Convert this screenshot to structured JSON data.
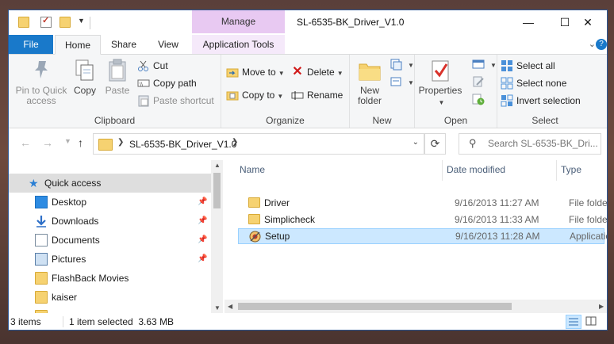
{
  "window": {
    "title": "SL-6535-BK_Driver_V1.0",
    "contextual_tab_group": "Manage",
    "min_glyph": "—",
    "max_glyph": "☐",
    "close_glyph": "✕"
  },
  "ribbon_tabs": {
    "file": "File",
    "home": "Home",
    "share": "Share",
    "view": "View",
    "application_tools": "Application Tools"
  },
  "clipboard": {
    "pin": "Pin to Quick access",
    "copy": "Copy",
    "paste": "Paste",
    "cut": "Cut",
    "copy_path": "Copy path",
    "paste_shortcut": "Paste shortcut",
    "label": "Clipboard"
  },
  "organize": {
    "move_to": "Move to",
    "copy_to": "Copy to",
    "delete": "Delete",
    "rename": "Rename",
    "label": "Organize"
  },
  "new_group": {
    "new_folder": "New folder",
    "label": "New"
  },
  "open_group": {
    "properties": "Properties",
    "label": "Open"
  },
  "select_group": {
    "select_all": "Select all",
    "select_none": "Select none",
    "invert_selection": "Invert selection",
    "label": "Select"
  },
  "address": {
    "path": "SL-6535-BK_Driver_V1.0",
    "search_placeholder": "Search SL-6535-BK_Dri..."
  },
  "nav": {
    "quick_access": "Quick access",
    "items": [
      {
        "label": "Desktop",
        "pinned": true
      },
      {
        "label": "Downloads",
        "pinned": true
      },
      {
        "label": "Documents",
        "pinned": true
      },
      {
        "label": "Pictures",
        "pinned": true
      },
      {
        "label": "FlashBack Movies",
        "pinned": false
      },
      {
        "label": "kaiser",
        "pinned": false
      }
    ]
  },
  "columns": {
    "name": "Name",
    "date_modified": "Date modified",
    "type": "Type"
  },
  "files": [
    {
      "name": "Driver",
      "date": "9/16/2013 11:27 AM",
      "type": "File folder",
      "icon": "folder-icon"
    },
    {
      "name": "Simplicheck",
      "date": "9/16/2013 11:33 AM",
      "type": "File folder",
      "icon": "folder-icon"
    },
    {
      "name": "Setup",
      "date": "9/16/2013 11:28 AM",
      "type": "Applicatio",
      "icon": "setup-app-icon",
      "selected": true
    }
  ],
  "status": {
    "item_count": "3 items",
    "selection": "1 item selected  3.63 MB"
  },
  "colors": {
    "file_tab": "#1979ca",
    "manage_tab": "#e8c9f2",
    "selection": "#cce8ff",
    "selection_border": "#99d1ff"
  }
}
